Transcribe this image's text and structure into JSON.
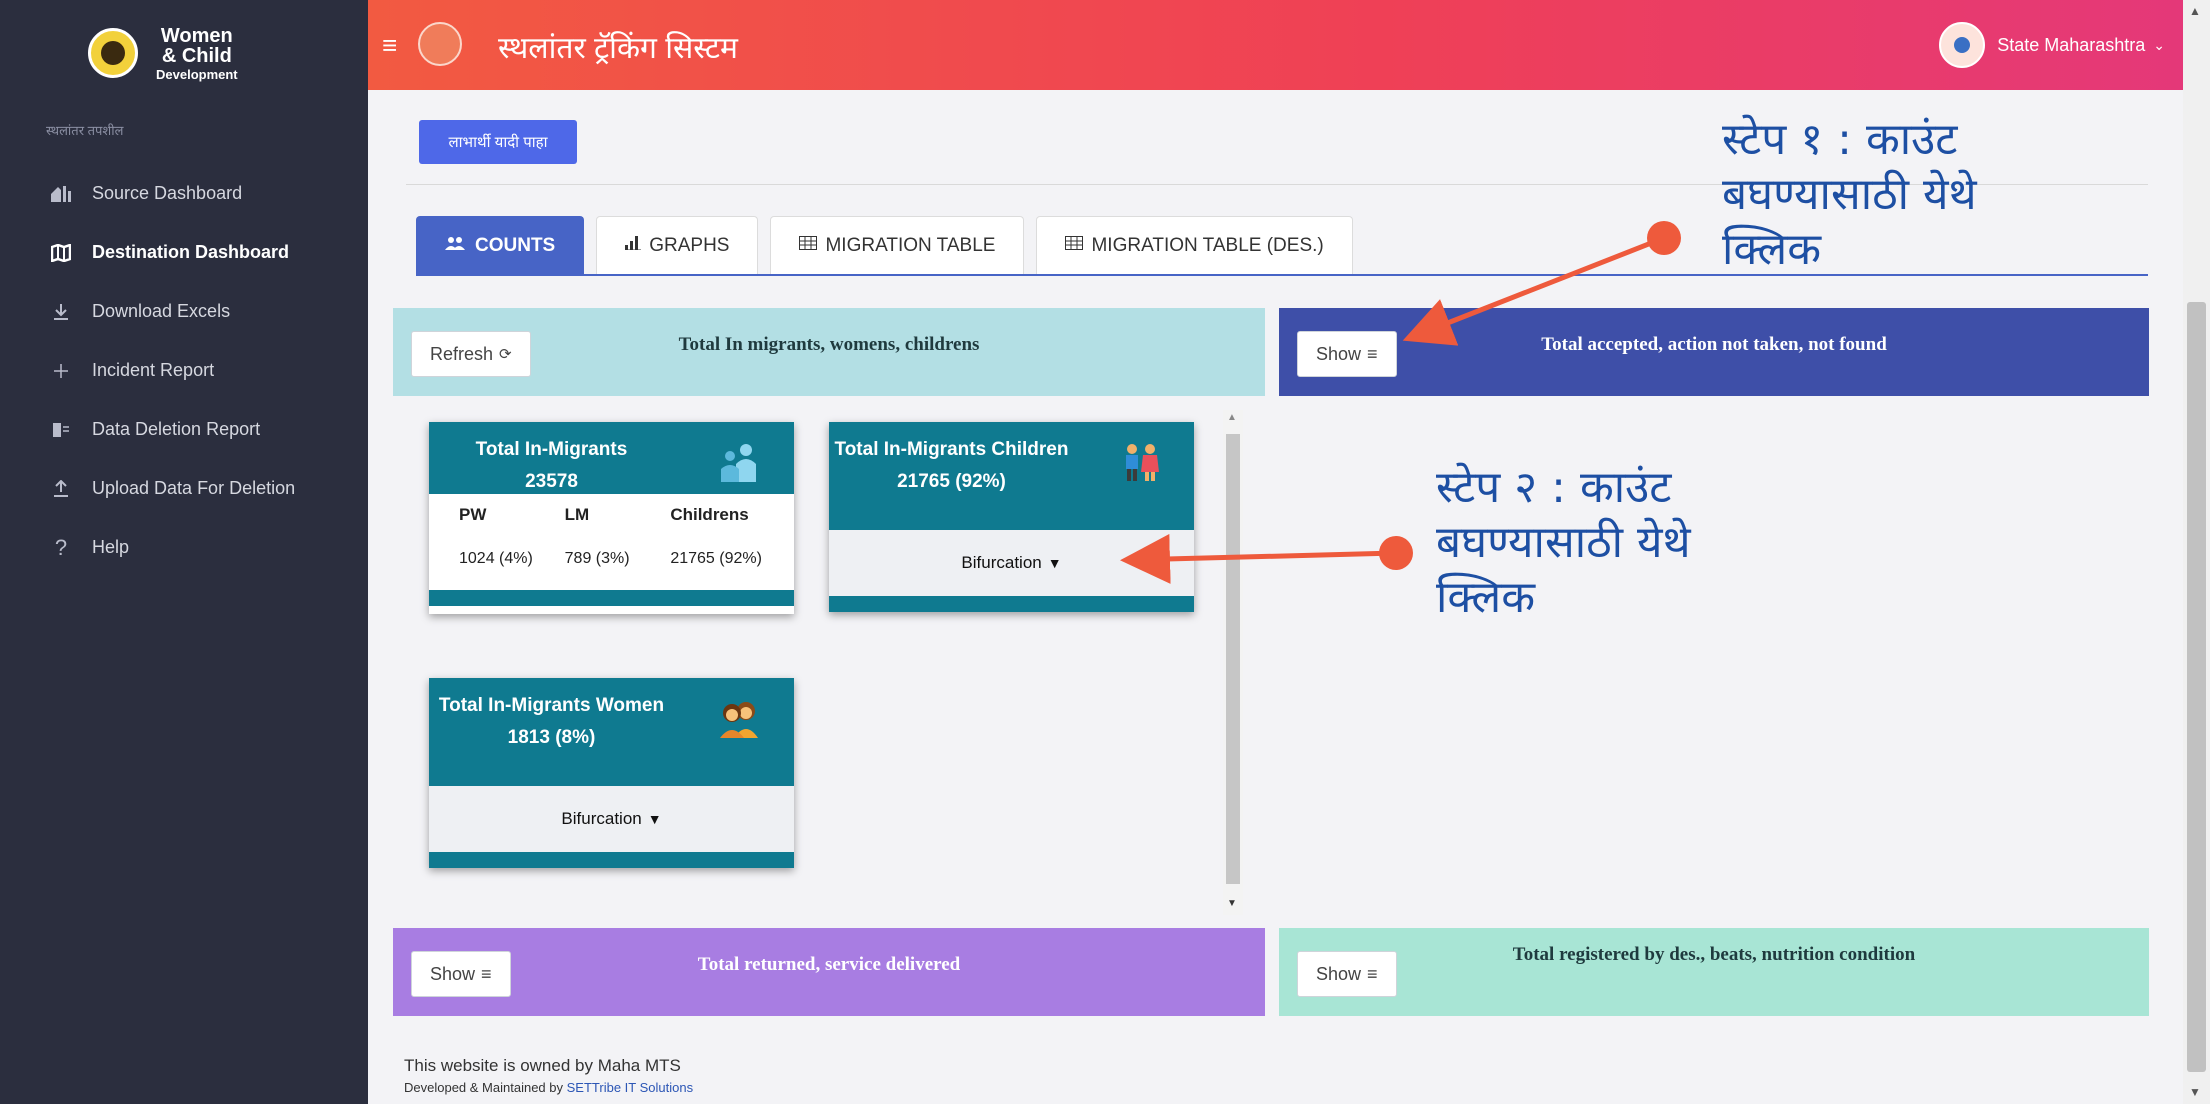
{
  "brand": {
    "line1": "Women",
    "line2": "& Child",
    "line3": "Development"
  },
  "sidebar": {
    "caption": "स्थलांतर तपशील",
    "items": [
      {
        "label": "Source Dashboard",
        "icon": "home-chart-icon"
      },
      {
        "label": "Destination Dashboard",
        "icon": "map-icon",
        "active": true
      },
      {
        "label": "Download Excels",
        "icon": "download-icon"
      },
      {
        "label": "Incident Report",
        "icon": "plus-icon"
      },
      {
        "label": "Data Deletion Report",
        "icon": "list-icon"
      },
      {
        "label": "Upload Data For Deletion",
        "icon": "upload-icon"
      },
      {
        "label": "Help",
        "icon": "question-icon"
      }
    ]
  },
  "header": {
    "title": "स्थलांतर ट्रॅकिंग सिस्टम",
    "user": "State Maharashtra"
  },
  "top_button": "लाभार्थी यादी पाहा",
  "tabs": [
    {
      "label": "COUNTS",
      "active": true
    },
    {
      "label": "GRAPHS"
    },
    {
      "label": "MIGRATION TABLE"
    },
    {
      "label": "MIGRATION TABLE (DES.)"
    }
  ],
  "panels": {
    "in_migrants": {
      "button": "Refresh",
      "title": "Total In migrants, womens, childrens",
      "color": "#b3dfe4"
    },
    "accepted": {
      "button": "Show",
      "title": "Total accepted, action not taken, not found",
      "color": "#3e4fa8"
    },
    "returned": {
      "button": "Show",
      "title": "Total returned, service delivered",
      "color": "#a87de2"
    },
    "registered": {
      "button": "Show",
      "title": "Total registered by des., beats, nutrition condition",
      "color": "#a8e5d5"
    }
  },
  "cards": {
    "total": {
      "title": "Total In-Migrants",
      "value": "23578",
      "headers": [
        "PW",
        "LM",
        "Childrens"
      ],
      "values": [
        "1024 (4%)",
        "789 (3%)",
        "21765 (92%)"
      ]
    },
    "children": {
      "title": "Total In-Migrants Children",
      "value": "21765 (92%)",
      "action": "Bifurcation"
    },
    "women": {
      "title": "Total In-Migrants Women",
      "value": "1813 (8%)",
      "action": "Bifurcation"
    }
  },
  "annotations": {
    "step1": "स्टेप १ : काउंट बघण्यासाठी येथे क्लिक",
    "step2": "स्टेप २ : काउंट बघण्यासाठी येथे क्लिक"
  },
  "footer": {
    "owned": "This website is owned by Maha MTS",
    "developed": "Developed & Maintained by",
    "company": "SETTribe IT Solutions"
  }
}
